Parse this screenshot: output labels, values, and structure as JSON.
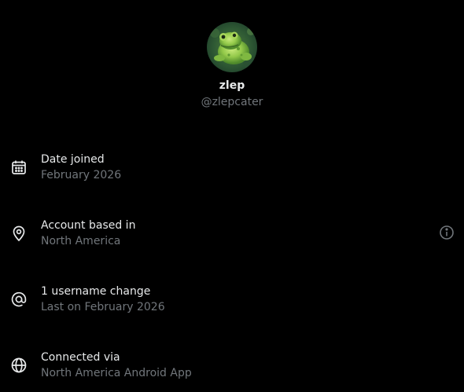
{
  "profile": {
    "display_name": "zlep",
    "handle": "@zlepcater"
  },
  "rows": [
    {
      "icon": "calendar-icon",
      "title": "Date joined",
      "subtitle": "February 2026"
    },
    {
      "icon": "location-pin-icon",
      "title": "Account based in",
      "subtitle": "North America",
      "action_icon": "info-icon"
    },
    {
      "icon": "at-sign-icon",
      "title": "1 username change",
      "subtitle": "Last on February 2026"
    },
    {
      "icon": "globe-icon",
      "title": "Connected via",
      "subtitle": "North America Android App"
    }
  ],
  "colors": {
    "background": "#000000",
    "primary_text": "#e7e9ea",
    "secondary_text": "#71767b"
  }
}
